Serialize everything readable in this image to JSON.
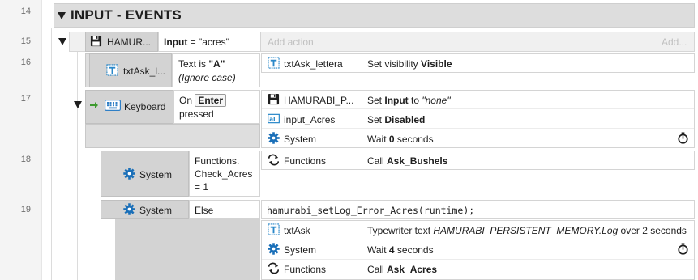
{
  "lines": [
    "14",
    "15",
    "16",
    "17",
    "18",
    "19"
  ],
  "group": {
    "title": "INPUT - EVENTS"
  },
  "event15": {
    "object": "HAMUR...",
    "cond_prefix": "Input",
    "cond_rest": " = \"acres\"",
    "add_action": "Add action",
    "add_more": "Add..."
  },
  "event16": {
    "object": "txtAsk_l...",
    "cond_line1_a": "Text is ",
    "cond_line1_b": "\"A\"",
    "cond_line2": "(Ignore case)",
    "action": {
      "object": "txtAsk_lettera",
      "text_a": "Set visibility ",
      "text_b": "Visible"
    }
  },
  "event17": {
    "object": "Keyboard",
    "cond_on": "On ",
    "cond_key": "Enter",
    "cond_pressed": "pressed",
    "actions": [
      {
        "object": "HAMURABI_P...",
        "text_a": "Set ",
        "text_b": "Input",
        "text_c": " to ",
        "text_d": "\"none\""
      },
      {
        "object": "input_Acres",
        "text_a": "Set ",
        "text_b": "Disabled"
      },
      {
        "object": "System",
        "text_a": "Wait ",
        "text_b": "0",
        "text_c": " seconds"
      }
    ]
  },
  "event18": {
    "object": "System",
    "cond_line1": "Functions.",
    "cond_line2": "Check_Acres",
    "cond_line3": "= 1",
    "action": {
      "object": "Functions",
      "text_a": "Call ",
      "text_b": "Ask_Bushels"
    }
  },
  "event19": {
    "object": "System",
    "cond": "Else",
    "script": "hamurabi_setLog_Error_Acres(runtime);",
    "actions": [
      {
        "object": "txtAsk",
        "text_a": "Typewriter text ",
        "text_b": "HAMURABI_PERSISTENT_MEMORY.Log",
        "text_c": " over 2 seconds"
      },
      {
        "object": "System",
        "text_a": "Wait ",
        "text_b": "4",
        "text_c": " seconds"
      },
      {
        "object": "Functions",
        "text_a": "Call ",
        "text_b": "Ask_Acres"
      }
    ]
  },
  "colors": {
    "gear": "#1a6fb8",
    "keyboard": "#2f7fc6",
    "arrow": "#3d9a2e",
    "text_icon": "#2a88c9"
  }
}
